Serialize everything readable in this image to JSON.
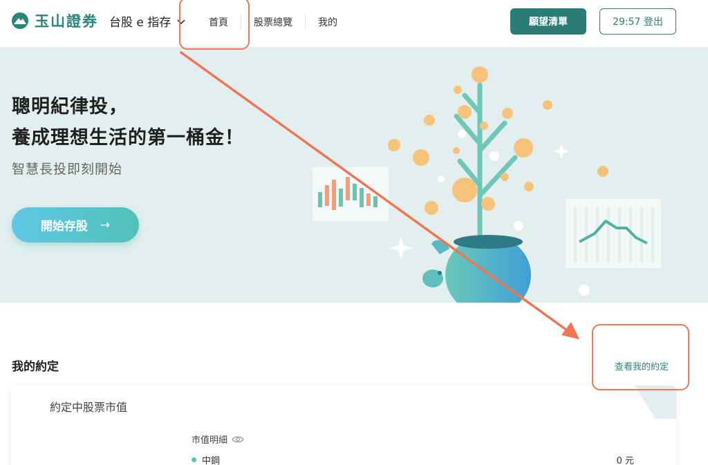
{
  "header": {
    "brand": "玉山證券",
    "app_name": "台股 e 指存",
    "nav": [
      "首頁",
      "股票總覽",
      "我的"
    ],
    "wishlist_label": "願望清單",
    "logout_label": "29:57 登出"
  },
  "hero": {
    "title_line1": "聰明紀律投，",
    "title_line2": "養成理想生活的第一桶金！",
    "subtitle": "智慧長投即刻開始",
    "cta_label": "開始存股",
    "cta_arrow": "→"
  },
  "section": {
    "title": "我的約定",
    "link_label": "查看我的約定"
  },
  "card": {
    "title": "約定中股票市值",
    "detail_label": "市值明細",
    "rows": [
      {
        "name": "中鋼",
        "value": "0 元"
      }
    ]
  },
  "colors": {
    "brand": "#2a8579",
    "primary_button": "#2a7d74",
    "hero_bg": "#e3efee",
    "annotation": "#f07552"
  },
  "icons": {
    "logo": "mountain-logo-icon",
    "chevron": "chevron-down-icon",
    "eye": "eye-icon"
  }
}
